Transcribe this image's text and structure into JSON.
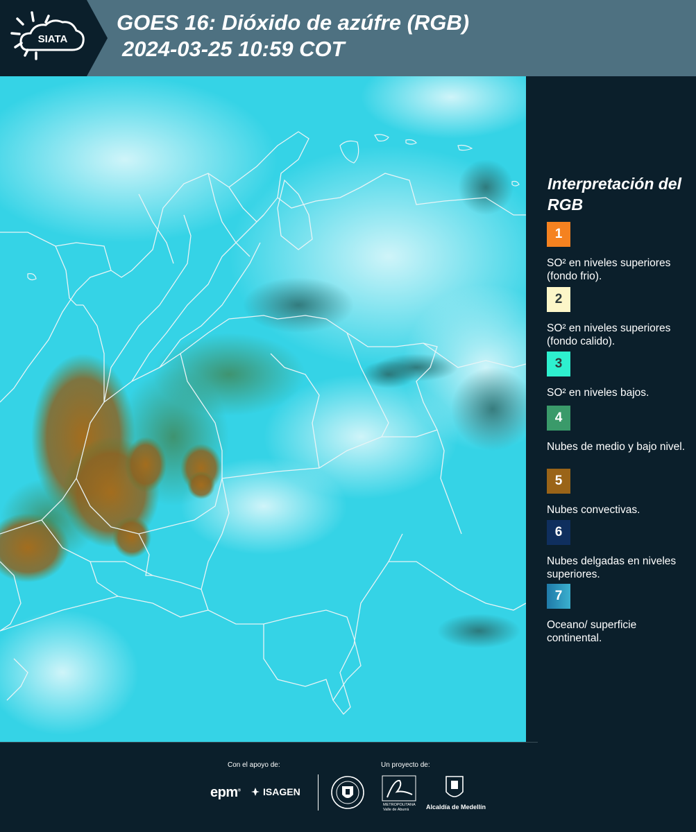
{
  "header": {
    "logo_text": "SIATA",
    "title_line1": "GOES 16: Dióxido de azúfre (RGB)",
    "title_line2": "2024-03-25 10:59 COT"
  },
  "colors": {
    "header_band": "#4e7181",
    "logo_band": "#0b1f2b",
    "background": "#0b1f2b",
    "map_base": "#35d3e6",
    "map_clouds": "#c9f2f8",
    "borders": "#e8f4f6"
  },
  "legend": {
    "title": "Interpretación del RGB",
    "items": [
      {
        "number": "1",
        "label": "SO² en niveles superiores (fondo frio).",
        "color": "#f58220"
      },
      {
        "number": "2",
        "label": "SO² en niveles superiores (fondo calido).",
        "color": "#fcf6c8"
      },
      {
        "number": "3",
        "label": "SO² en niveles bajos.",
        "color": "#2ef0cf"
      },
      {
        "number": "4",
        "label": "Nubes de medio y bajo nivel.",
        "color": "#3a9a6a"
      },
      {
        "number": "5",
        "label": "Nubes convectivas.",
        "color": "#9a6418"
      },
      {
        "number": "6",
        "label": "Nubes delgadas en niveles superiores.",
        "color": "#0f2f5e"
      },
      {
        "number": "7",
        "label": "Oceano/ superficie continental.",
        "color": "#2a92b6"
      }
    ]
  },
  "footer": {
    "support_label": "Con el apoyo de:",
    "project_label": "Un proyecto de:",
    "epm": "epm",
    "isagen": "ISAGEN",
    "area_caption_1": "METROPOLITANA",
    "area_caption_2": "Valle de Aburrá",
    "alcaldia": "Alcaldía de Medellín"
  }
}
